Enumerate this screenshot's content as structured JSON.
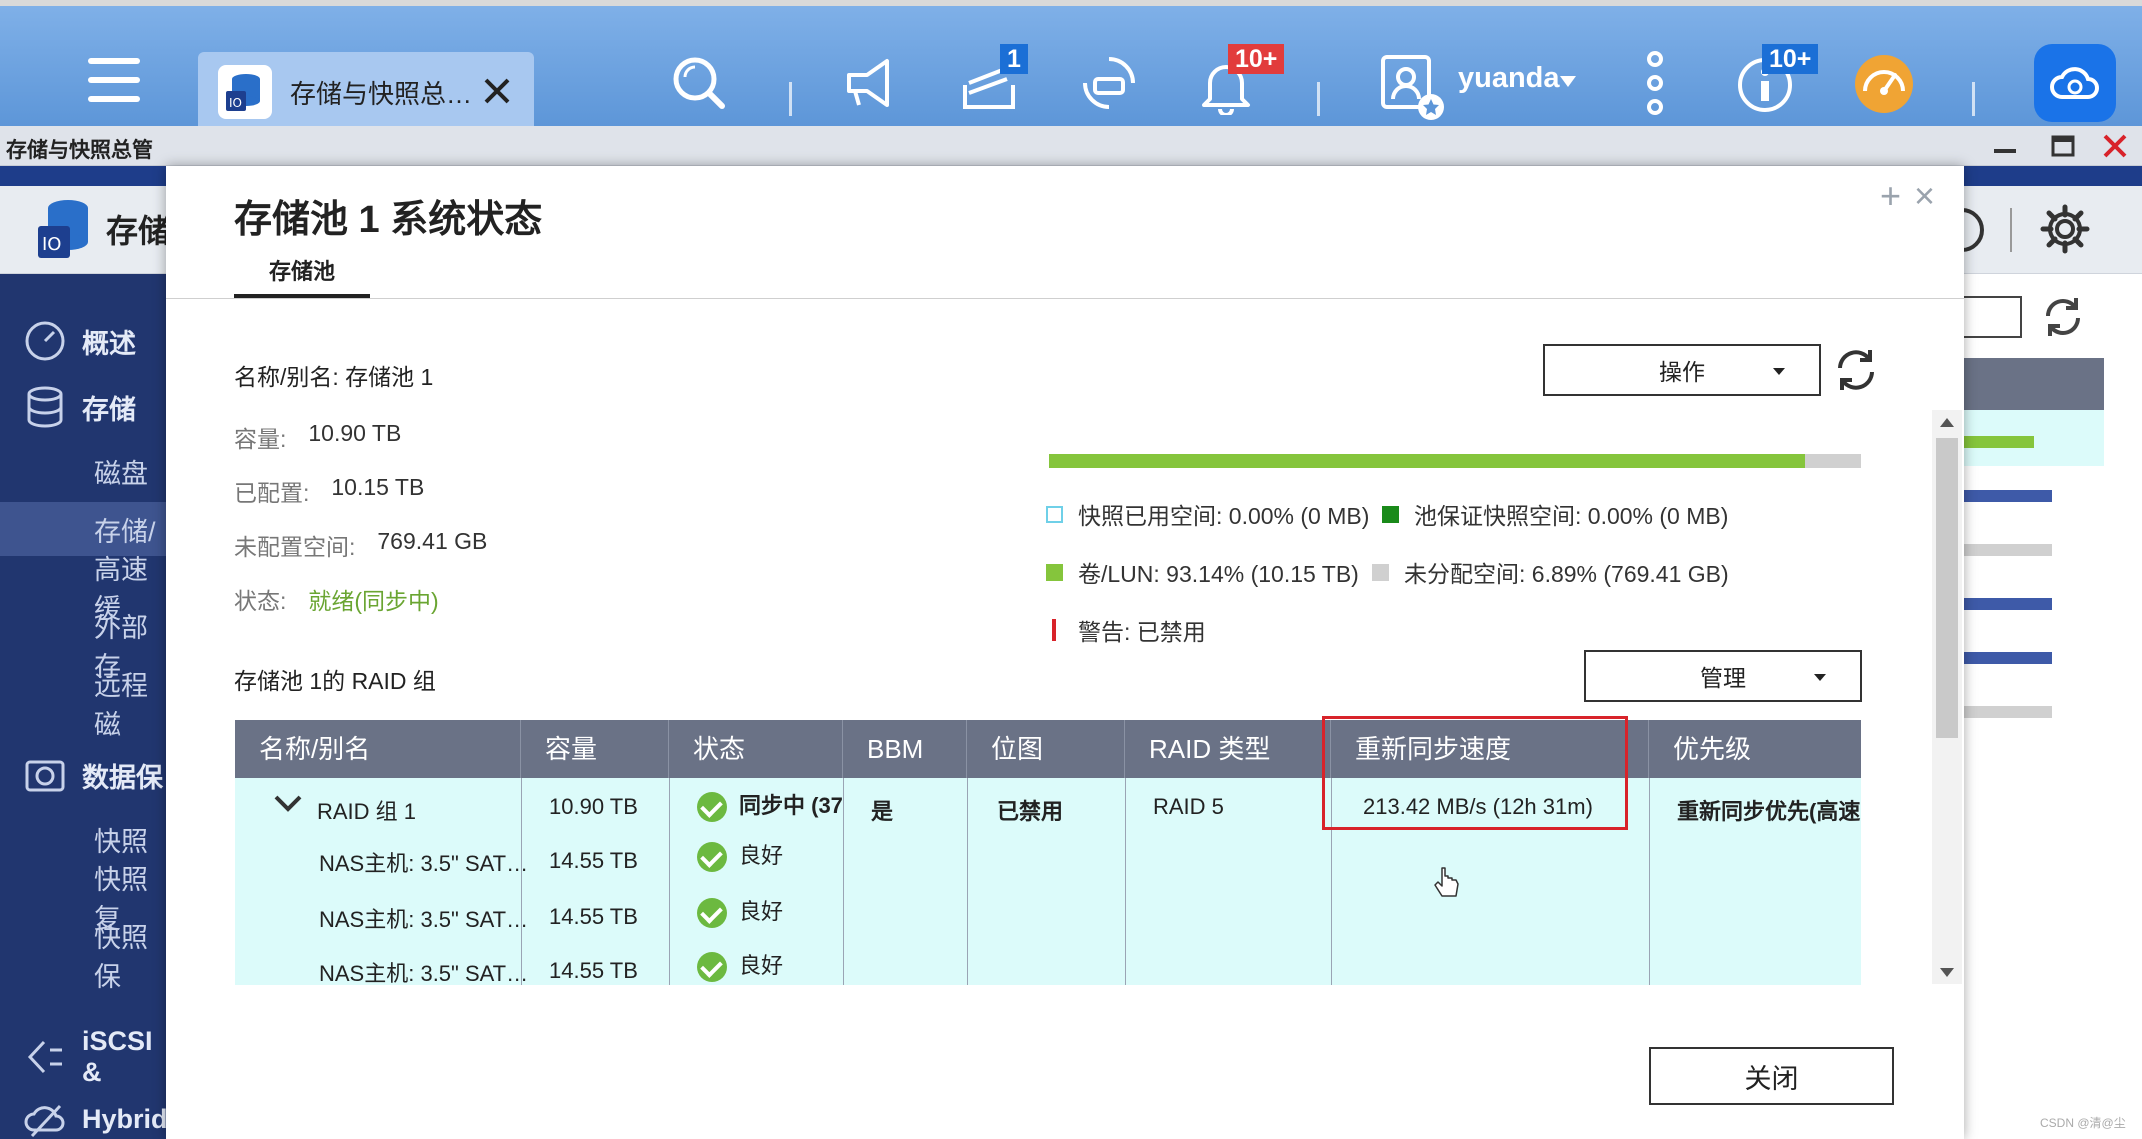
{
  "taskbar": {
    "tab_label": "存储与快照总…",
    "badges": {
      "tasks": "1",
      "notifications": "10+",
      "info": "10+"
    },
    "user": "yuanda"
  },
  "window": {
    "title": "存储与快照总管",
    "app_title_partial": "存储"
  },
  "sidebar": {
    "items": [
      {
        "label": "概述"
      },
      {
        "label": "存储"
      },
      {
        "label": "磁盘"
      },
      {
        "label": "存储/"
      },
      {
        "label": "高速缓"
      },
      {
        "label": "外部存"
      },
      {
        "label": "远程磁"
      },
      {
        "label": "数据保"
      },
      {
        "label": "快照"
      },
      {
        "label": "快照复"
      },
      {
        "label": "快照保"
      },
      {
        "label": "iSCSI &"
      },
      {
        "label": "Hybrid"
      }
    ]
  },
  "modal": {
    "title": "存储池 1 系统状态",
    "tab": "存储池",
    "name_row": "名称/别名: 存储池 1",
    "info": [
      {
        "key": "容量:",
        "value": "10.90 TB"
      },
      {
        "key": "已配置:",
        "value": "10.15 TB"
      },
      {
        "key": "未配置空间:",
        "value": "769.41 GB"
      },
      {
        "key": "状态:",
        "value": "就绪(同步中)"
      }
    ],
    "actions_label": "操作",
    "manage_label": "管理",
    "usage_fraction": 0.9314,
    "legend": {
      "snapshot": "快照已用空间: 0.00% (0 MB)",
      "guaranteed": "池保证快照空间: 0.00% (0 MB)",
      "volume": "卷/LUN: 93.14% (10.15 TB)",
      "unallocated": "未分配空间: 6.89% (769.41 GB)",
      "warning": "警告: 已禁用"
    },
    "raid_section_title": "存储池 1的 RAID 组",
    "table": {
      "headers": [
        "名称/别名",
        "容量",
        "状态",
        "BBM",
        "位图",
        "RAID 类型",
        "重新同步速度",
        "优先级"
      ],
      "group": {
        "name": "RAID 组 1",
        "capacity": "10.90 TB",
        "status": "同步中 (37",
        "bbm": "是",
        "bitmap": "已禁用",
        "raid_type": "RAID 5",
        "resync_speed": "213.42 MB/s (12h 31m)",
        "priority": "重新同步优先(高速"
      },
      "disks": [
        {
          "name": "NAS主机: 3.5\" SAT…",
          "capacity": "14.55 TB",
          "status": "良好"
        },
        {
          "name": "NAS主机: 3.5\" SAT…",
          "capacity": "14.55 TB",
          "status": "良好"
        },
        {
          "name": "NAS主机: 3.5\" SAT…",
          "capacity": "14.55 TB",
          "status": "良好"
        }
      ]
    },
    "close_label": "关闭"
  },
  "watermark": "CSDN @清@尘",
  "colors": {
    "accent": "#5d96d8",
    "ok": "#6aa532",
    "bar": "#85c53c",
    "highlight": "#d8232a",
    "table_header": "#6a7286",
    "table_row": "#dcfbfa"
  }
}
